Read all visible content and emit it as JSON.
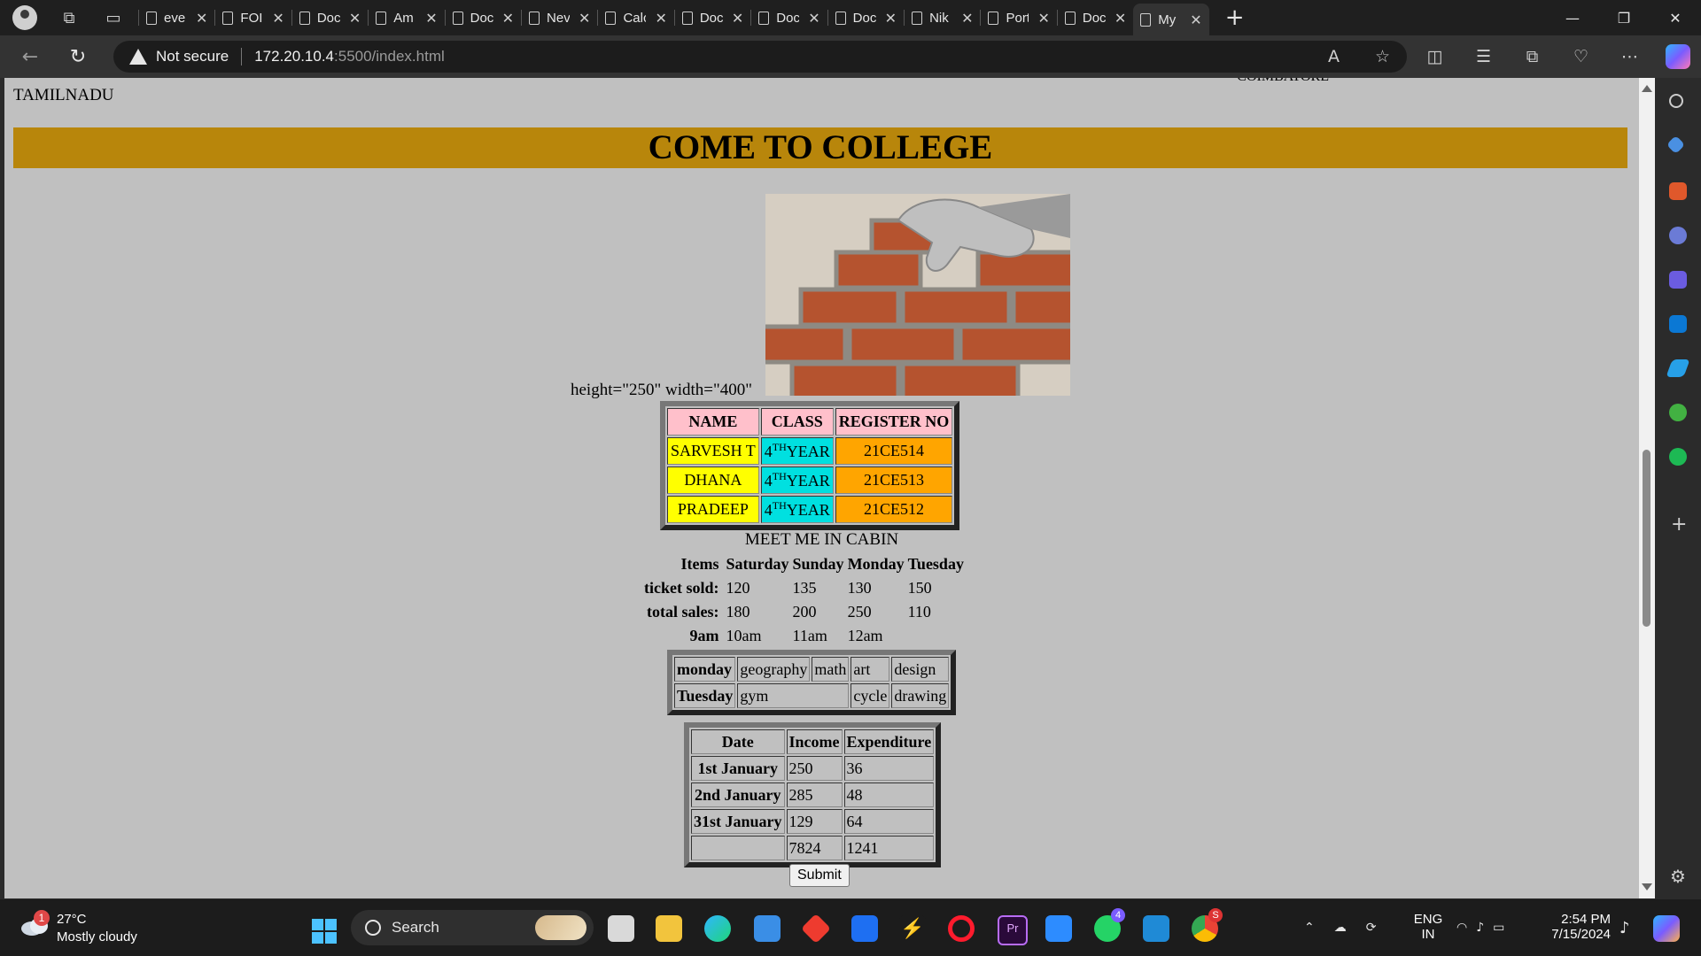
{
  "browser": {
    "tabs": [
      {
        "title": "eve"
      },
      {
        "title": "FOI"
      },
      {
        "title": "Doc"
      },
      {
        "title": "Am"
      },
      {
        "title": "Doc"
      },
      {
        "title": "Nev"
      },
      {
        "title": "Calc"
      },
      {
        "title": "Doc"
      },
      {
        "title": "Doc"
      },
      {
        "title": "Doc"
      },
      {
        "title": "Nik"
      },
      {
        "title": "Port"
      },
      {
        "title": "Doc"
      },
      {
        "title": "My"
      }
    ],
    "security_label": "Not secure",
    "url_host": "172.20.10.4",
    "url_path": ":5500/index.html"
  },
  "page": {
    "state_text": "TAMILNADU",
    "top_right_text": "COIMBATORE",
    "banner": "COME TO COLLEGE",
    "img_caption": "height=\"250\" width=\"400\"",
    "students": {
      "headers": [
        "NAME",
        "CLASS",
        "REGISTER NO"
      ],
      "rows": [
        {
          "name": "SARVESH T",
          "class_num": "4",
          "class_sup": "TH",
          "class_suffix": "YEAR",
          "reg": "21CE514"
        },
        {
          "name": "DHANA",
          "class_num": "4",
          "class_sup": "TH",
          "class_suffix": "YEAR",
          "reg": "21CE513"
        },
        {
          "name": "PRADEEP",
          "class_num": "4",
          "class_sup": "TH",
          "class_suffix": "YEAR",
          "reg": "21CE512"
        }
      ]
    },
    "sales": {
      "caption": "MEET ME IN CABIN",
      "headers": [
        "Items",
        "Saturday",
        "Sunday",
        "Monday",
        "Tuesday"
      ],
      "rows": [
        {
          "label": "ticket sold:",
          "values": [
            "120",
            "135",
            "130",
            "150"
          ]
        },
        {
          "label": "total sales:",
          "values": [
            "180",
            "200",
            "250",
            "110"
          ]
        },
        {
          "label": "9am",
          "values": [
            "10am",
            "11am",
            "12am",
            ""
          ]
        }
      ]
    },
    "timetable": {
      "rows": [
        {
          "day": "monday",
          "cells": [
            "geography",
            "math",
            "art",
            "design"
          ]
        },
        {
          "day": "Tuesday",
          "cells": [
            "gym",
            "cycle",
            "drawing"
          ]
        }
      ]
    },
    "finance": {
      "headers": [
        "Date",
        "Income",
        "Expenditure"
      ],
      "rows": [
        {
          "date": "1st January",
          "income": "250",
          "exp": "36"
        },
        {
          "date": "2nd January",
          "income": "285",
          "exp": "48"
        },
        {
          "date": "31st January",
          "income": "129",
          "exp": "64"
        },
        {
          "date": "",
          "income": "7824",
          "exp": "1241"
        }
      ]
    },
    "submit_label": "Submit"
  },
  "taskbar": {
    "weather_temp": "27°C",
    "weather_desc": "Mostly cloudy",
    "weather_badge": "1",
    "search_label": "Search",
    "lang_top": "ENG",
    "lang_bottom": "IN",
    "time": "2:54 PM",
    "date": "7/15/2024",
    "whatsapp_badge": "4",
    "chrome_badge": "S"
  },
  "colors": {
    "banner": "#b8860b",
    "page_bg": "#c0c0c0",
    "name_cell": "#ffff00",
    "class_cell": "#00e0e0",
    "reg_cell": "#ffa500",
    "header_cell": "#ffc0cb"
  }
}
